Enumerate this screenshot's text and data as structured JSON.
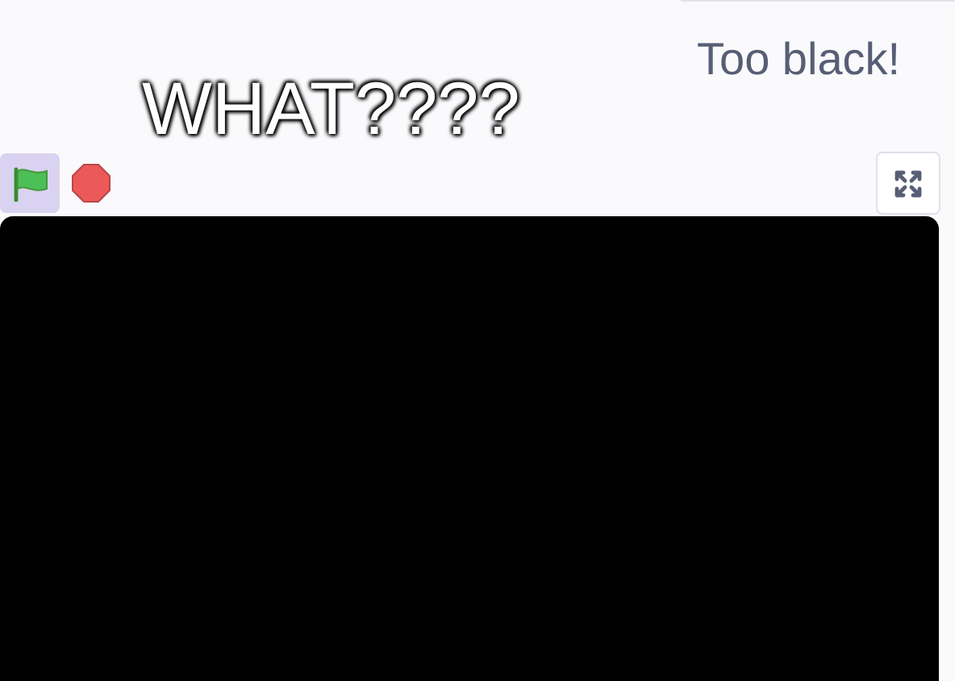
{
  "caption": "WHAT????",
  "speech": "Too black!",
  "controls": {
    "green_flag": {
      "running": true
    }
  },
  "stage": {
    "kind": "blank"
  }
}
